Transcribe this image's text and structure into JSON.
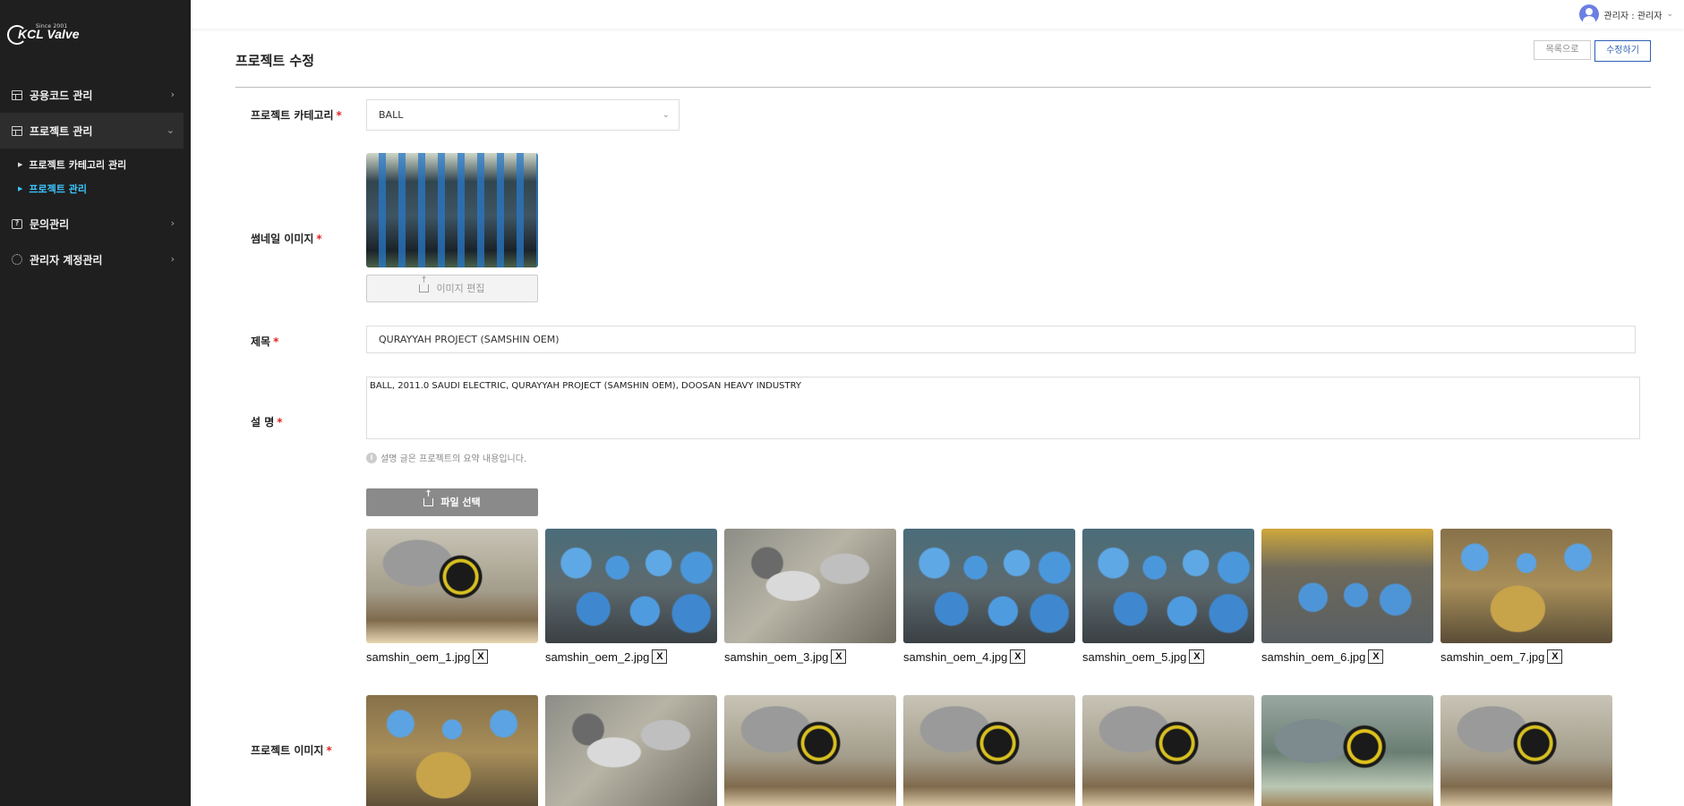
{
  "logo": {
    "since": "Since 2001",
    "brand": "KCL Valve"
  },
  "sidebar": {
    "items": [
      {
        "label": "공용코드 관리",
        "icon": "table-icon",
        "expanded": false
      },
      {
        "label": "프로젝트 관리",
        "icon": "table-icon",
        "expanded": true,
        "children": [
          {
            "label": "프로젝트 카테고리 관리"
          },
          {
            "label": "프로젝트 관리",
            "current": true
          }
        ]
      },
      {
        "label": "문의관리",
        "icon": "help-icon",
        "expanded": false
      },
      {
        "label": "관리자 계정관리",
        "icon": "gear-icon",
        "expanded": false
      }
    ]
  },
  "topbar": {
    "user_label": "관리자 : 관리자"
  },
  "page": {
    "title": "프로젝트 수정",
    "btn_list": "목록으로",
    "btn_edit": "수정하기"
  },
  "form": {
    "category": {
      "label": "프로젝트 카테고리",
      "value": "BALL"
    },
    "thumbnail": {
      "label": "썸네일 이미지",
      "button": "이미지 편집"
    },
    "title": {
      "label": "제목",
      "value": "QURAYYAH PROJECT (SAMSHIN OEM)"
    },
    "description": {
      "label": "설 명",
      "value": "BALL, 2011.0 SAUDI ELECTRIC, QURAYYAH PROJECT (SAMSHIN OEM), DOOSAN HEAVY INDUSTRY",
      "hint": "설명 글은 프로젝트의 요약 내용입니다."
    },
    "project_images": {
      "label": "프로젝트 이미지",
      "file_button": "파일 선택",
      "remove_label": "X",
      "files_row1": [
        "samshin_oem_1.jpg",
        "samshin_oem_2.jpg",
        "samshin_oem_3.jpg",
        "samshin_oem_4.jpg",
        "samshin_oem_5.jpg",
        "samshin_oem_6.jpg",
        "samshin_oem_7.jpg"
      ]
    }
  },
  "colors": {
    "accent": "#2f5fb3",
    "sidebar_bg": "#1f1f1f",
    "current_sub": "#3cc6ff",
    "required": "#e02424"
  }
}
